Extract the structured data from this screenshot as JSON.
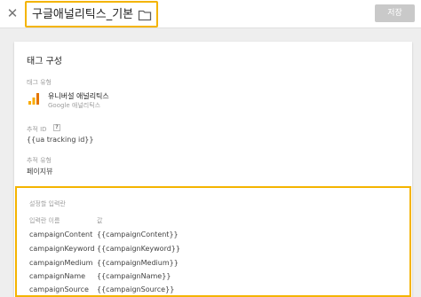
{
  "header": {
    "title": "구글애널리틱스_기본",
    "close_icon": "close-icon",
    "folder_icon": "folder-icon",
    "save_label": "저장"
  },
  "card": {
    "title": "태그 구성",
    "tag_type": {
      "label": "태그 유형",
      "name": "유니버설 애널리틱스",
      "sub": "Google 애널리틱스",
      "icon": "google-analytics-icon",
      "icon_colors": [
        "#f9ab00",
        "#e37400"
      ]
    },
    "tracking_id": {
      "label": "추적 ID",
      "help_icon": "?",
      "value": "{{ua tracking id}}"
    },
    "tracking_type": {
      "label": "추적 유형",
      "value": "페이지뷰"
    }
  },
  "settings": {
    "title": "설정할 입력란",
    "col_name": "입력란 이름",
    "col_value": "값",
    "rows": [
      {
        "name": "campaignContent",
        "value": "{{campaignContent}}"
      },
      {
        "name": "campaignKeyword",
        "value": "{{campaignKeyword}}"
      },
      {
        "name": "campaignMedium",
        "value": "{{campaignMedium}}"
      },
      {
        "name": "campaignName",
        "value": "{{campaignName}}"
      },
      {
        "name": "campaignSource",
        "value": "{{campaignSource}}"
      }
    ]
  },
  "colors": {
    "highlight": "#f4b400",
    "save_button": "#c9c9c9"
  }
}
